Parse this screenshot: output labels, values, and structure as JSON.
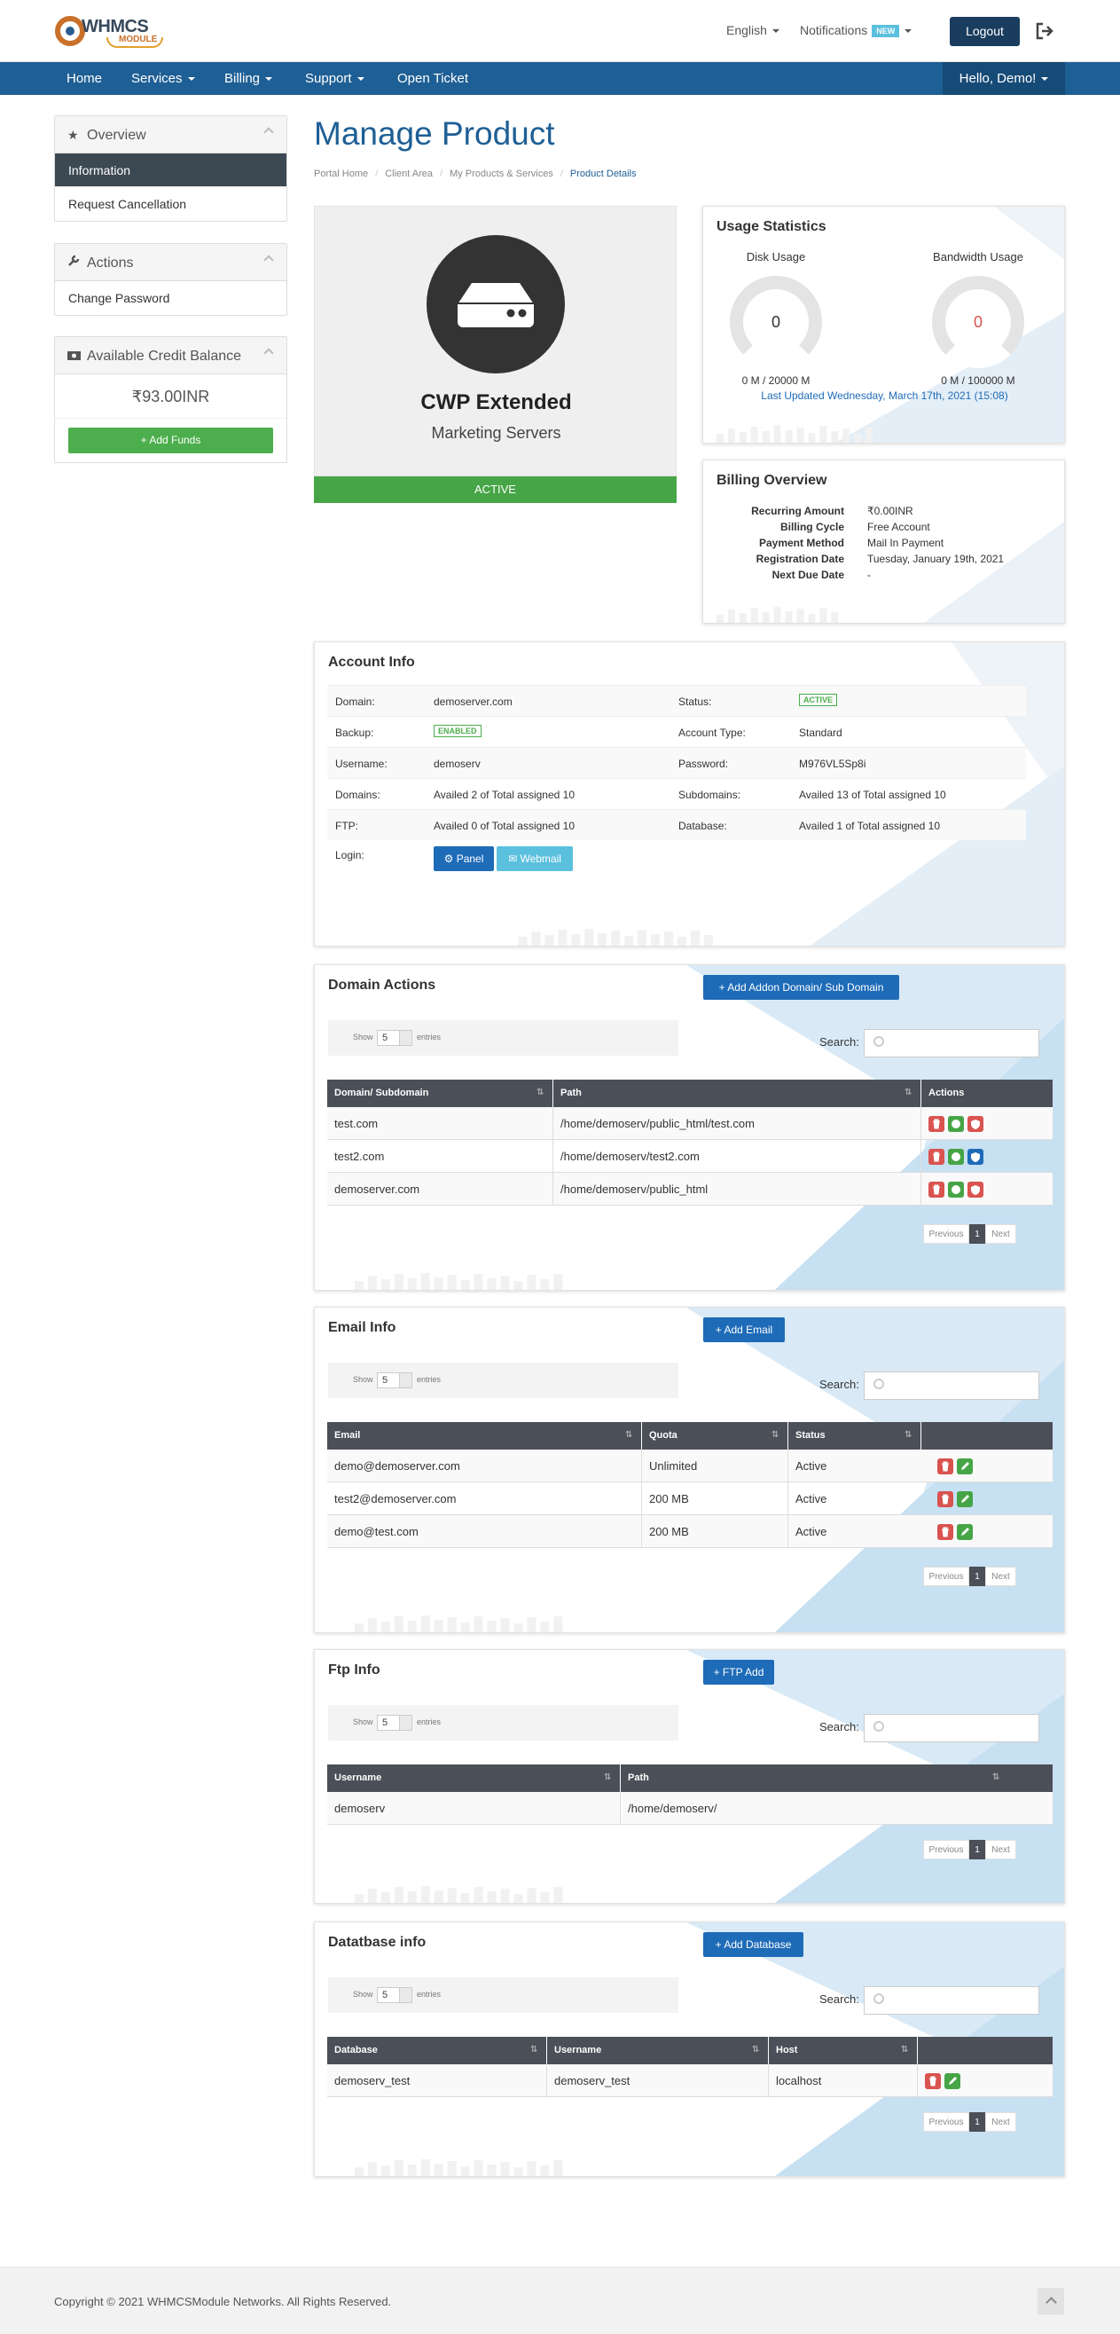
{
  "header": {
    "logo_text": "WHMCS",
    "logo_sub": "MODULE",
    "language": "English",
    "notifications": "Notifications",
    "new_badge": "NEW",
    "logout": "Logout"
  },
  "nav": {
    "items": [
      "Home",
      "Services",
      "Billing",
      "Support",
      "Open Ticket"
    ],
    "user": "Hello, Demo!"
  },
  "sidebar": {
    "overview": {
      "title": "Overview",
      "items": [
        "Information",
        "Request Cancellation"
      ]
    },
    "actions": {
      "title": "Actions",
      "items": [
        "Change Password"
      ]
    },
    "credit": {
      "title": "Available Credit Balance",
      "amount": "₹93.00INR",
      "add_funds": "Add Funds"
    }
  },
  "page": {
    "title": "Manage Product",
    "breadcrumb": [
      "Portal Home",
      "Client Area",
      "My Products & Services",
      "Product Details"
    ]
  },
  "product": {
    "name": "CWP Extended",
    "group": "Marketing Servers",
    "status": "ACTIVE"
  },
  "usage": {
    "title": "Usage Statistics",
    "disk_label": "Disk Usage",
    "disk_value": "0",
    "disk_detail": "0 M / 20000 M",
    "bw_label": "Bandwidth Usage",
    "bw_value": "0",
    "bw_detail": "0 M / 100000 M",
    "updated": "Last Updated Wednesday, March 17th, 2021 (15:08)"
  },
  "billing": {
    "title": "Billing Overview",
    "rows": [
      {
        "k": "Recurring Amount",
        "v": "₹0.00INR"
      },
      {
        "k": "Billing Cycle",
        "v": "Free Account"
      },
      {
        "k": "Payment Method",
        "v": "Mail In Payment"
      },
      {
        "k": "Registration Date",
        "v": "Tuesday, January 19th, 2021"
      },
      {
        "k": "Next Due Date",
        "v": "-"
      }
    ]
  },
  "account": {
    "title": "Account Info",
    "rows": [
      {
        "k1": "Domain:",
        "v1": "demoserver.com",
        "k2": "Status:",
        "v2": "ACTIVE"
      },
      {
        "k1": "Backup:",
        "v1": "ENABLED",
        "k2": "Account Type:",
        "v2": "Standard"
      },
      {
        "k1": "Username:",
        "v1": "demoserv",
        "k2": "Password:",
        "v2": "M976VL5Sp8i"
      },
      {
        "k1": "Domains:",
        "v1": "Availed 2 of Total assigned 10",
        "k2": "Subdomains:",
        "v2": "Availed 13 of Total assigned 10"
      },
      {
        "k1": "FTP:",
        "v1": "Availed 0 of Total assigned 10",
        "k2": "Database:",
        "v2": "Availed 1 of Total assigned 10"
      }
    ],
    "login_label": "Login:",
    "panel_btn": "Panel",
    "webmail_btn": "Webmail"
  },
  "dt": {
    "show": "Show",
    "entries": "entries",
    "length": "5",
    "search": "Search:",
    "prev": "Previous",
    "page": "1",
    "next": "Next"
  },
  "domain_actions": {
    "title": "Domain Actions",
    "add": "Add Addon Domain/ Sub Domain",
    "cols": [
      "Domain/ Subdomain",
      "Path",
      "Actions"
    ],
    "rows": [
      [
        "test.com",
        "/home/demoserv/public_html/test.com"
      ],
      [
        "test2.com",
        "/home/demoserv/test2.com"
      ],
      [
        "demoserver.com",
        "/home/demoserv/public_html"
      ]
    ]
  },
  "email": {
    "title": "Email Info",
    "add": "Add Email",
    "cols": [
      "Email",
      "Quota",
      "Status",
      ""
    ],
    "rows": [
      [
        "demo@demoserver.com",
        "Unlimited",
        "Active"
      ],
      [
        "test2@demoserver.com",
        "200 MB",
        "Active"
      ],
      [
        "demo@test.com",
        "200 MB",
        "Active"
      ]
    ]
  },
  "ftp": {
    "title": "Ftp Info",
    "add": "FTP Add",
    "cols": [
      "Username",
      "Path"
    ],
    "rows": [
      [
        "demoserv",
        "/home/demoserv/"
      ]
    ]
  },
  "database": {
    "title": "Datatbase info",
    "add": "Add Database",
    "cols": [
      "Database",
      "Username",
      "Host",
      ""
    ],
    "rows": [
      [
        "demoserv_test",
        "demoserv_test",
        "localhost"
      ]
    ]
  },
  "footer": {
    "copyright": "Copyright © 2021 WHMCSModule Networks. All Rights Reserved."
  },
  "colors": {
    "primary": "#1e5f95",
    "success": "#46a546",
    "danger": "#d9534f",
    "info": "#5bc0de",
    "dark": "#4b4f57"
  }
}
